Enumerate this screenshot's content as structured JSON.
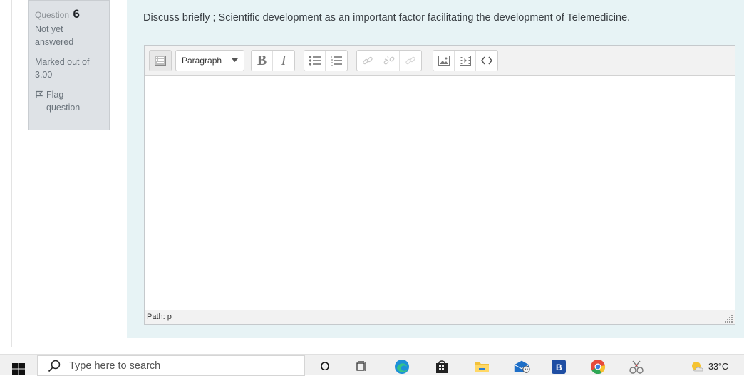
{
  "question_info": {
    "label": "Question",
    "number": "6",
    "state": "Not yet answered",
    "grade": "Marked out of 3.00",
    "flag_label": "Flag question"
  },
  "question": {
    "text": "Discuss briefly ; Scientific development as an important factor facilitating the development of Telemedicine."
  },
  "editor": {
    "format_select": "Paragraph",
    "bold_label": "B",
    "italic_label": "I",
    "status_path": "Path: p"
  },
  "taskbar": {
    "search_placeholder": "Type here to search",
    "temperature": "33°C",
    "taskview_label": "O"
  }
}
